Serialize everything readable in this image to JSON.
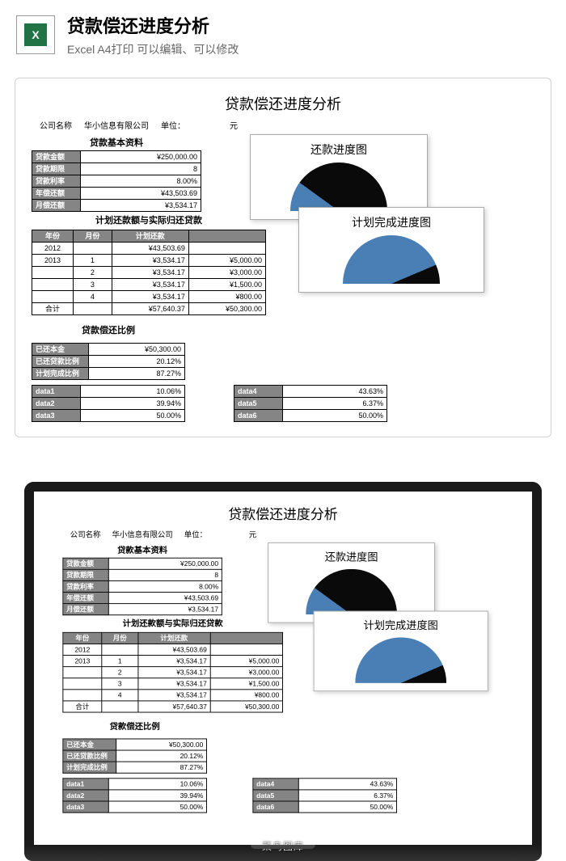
{
  "header": {
    "icon_text": "X",
    "title": "贷款偿还进度分析",
    "subtitle": "Excel A4打印 可以编辑、可以修改"
  },
  "doc": {
    "title": "贷款偿还进度分析",
    "company_label": "公司名称",
    "company_value": "华小信息有限公司",
    "unit_label": "单位：",
    "unit_value": "元",
    "basic_title": "贷款基本资料",
    "basic": {
      "amount_lbl": "贷款金额",
      "amount_val": "¥250,000.00",
      "term_lbl": "贷款期限",
      "term_val": "8",
      "rate_lbl": "贷款利率",
      "rate_val": "8.00%",
      "yearly_lbl": "年偿还额",
      "yearly_val": "¥43,503.69",
      "monthly_lbl": "月偿还额",
      "monthly_val": "¥3,534.17"
    },
    "plan_title": "计划还款额与实际归还贷款",
    "plan_headers": {
      "year": "年份",
      "month": "月份",
      "plan": "计划还款"
    },
    "plan_rows": [
      {
        "y": "2012",
        "m": "",
        "p": "¥43,503.69",
        "a": ""
      },
      {
        "y": "2013",
        "m": "1",
        "p": "¥3,534.17",
        "a": "¥5,000.00"
      },
      {
        "y": "",
        "m": "2",
        "p": "¥3,534.17",
        "a": "¥3,000.00"
      },
      {
        "y": "",
        "m": "3",
        "p": "¥3,534.17",
        "a": "¥1,500.00"
      },
      {
        "y": "",
        "m": "4",
        "p": "¥3,534.17",
        "a": "¥800.00"
      }
    ],
    "plan_total_lbl": "合计",
    "plan_total_p": "¥57,640.37",
    "plan_total_a": "¥50,300.00",
    "ratio_title": "贷款偿还比例",
    "ratio": {
      "principal_lbl": "已还本金",
      "principal_val": "¥50,300.00",
      "repay_lbl": "已还贷款比例",
      "repay_val": "20.12%",
      "complete_lbl": "计划完成比例",
      "complete_val": "87.27%"
    },
    "data_left": [
      {
        "k": "data1",
        "v": "10.06%"
      },
      {
        "k": "data2",
        "v": "39.94%"
      },
      {
        "k": "data3",
        "v": "50.00%"
      }
    ],
    "data_right": [
      {
        "k": "data4",
        "v": "43.63%"
      },
      {
        "k": "data5",
        "v": "6.37%"
      },
      {
        "k": "data6",
        "v": "50.00%"
      }
    ]
  },
  "chart_data": [
    {
      "type": "pie",
      "title": "还款进度图",
      "series": [
        {
          "name": "data1",
          "value": 10.06,
          "color": "#4a7fb5"
        },
        {
          "name": "data2",
          "value": 39.94,
          "color": "#0a0a0a"
        },
        {
          "name": "data3",
          "value": 50.0,
          "color": "transparent"
        }
      ],
      "note": "semi-donut gauge; bottom half hidden"
    },
    {
      "type": "pie",
      "title": "计划完成进度图",
      "series": [
        {
          "name": "data4",
          "value": 43.63,
          "color": "#4a7fb5"
        },
        {
          "name": "data5",
          "value": 6.37,
          "color": "#0a0a0a"
        },
        {
          "name": "data6",
          "value": 50.0,
          "color": "transparent"
        }
      ],
      "note": "semi-donut gauge; bottom half hidden"
    }
  ],
  "watermark": "菜鸟图库"
}
